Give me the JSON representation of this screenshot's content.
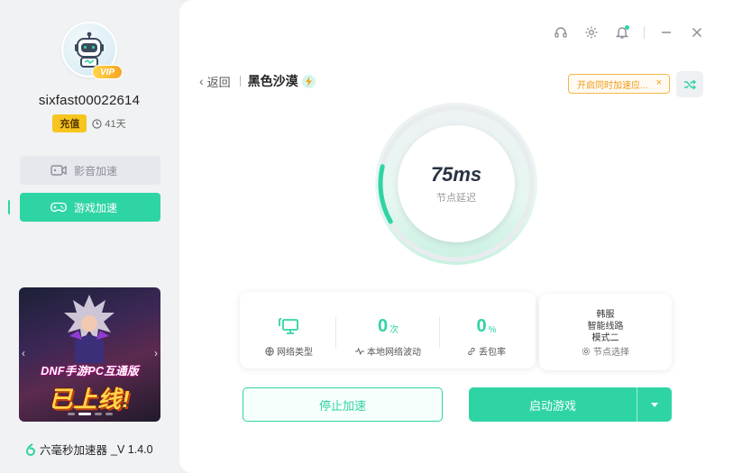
{
  "user": {
    "name": "sixfast00022614",
    "vip_label": "VIP",
    "recharge_label": "充值",
    "days_left": "41天"
  },
  "sidebar": {
    "items": [
      {
        "label": "影音加速",
        "icon": "video-icon",
        "active": false
      },
      {
        "label": "游戏加速",
        "icon": "gamepad-icon",
        "active": true
      }
    ]
  },
  "banner": {
    "line1": "DNF手游PC互通版",
    "line2": "已上线!"
  },
  "app": {
    "name": "六毫秒加速器",
    "version": "_V 1.4.0"
  },
  "header": {
    "back_label": "返回",
    "game_title": "黑色沙漠",
    "sim_tag": "开启同时加速应...",
    "sim_tag_close": "×"
  },
  "latency": {
    "value": "75ms",
    "label": "节点延迟",
    "ring_fraction": 0.12
  },
  "stats": [
    {
      "value": "",
      "unit": "",
      "label": "网络类型",
      "icon": "monitor-icon",
      "label_icon": "globe-icon"
    },
    {
      "value": "0",
      "unit": "次",
      "label": "本地网络波动",
      "label_icon": "pulse-icon"
    },
    {
      "value": "0",
      "unit": "%",
      "label": "丢包率",
      "label_icon": "link-icon"
    }
  ],
  "node": {
    "lines": [
      "韩服",
      "智能线路",
      "模式二"
    ],
    "label": "节点选择"
  },
  "actions": {
    "stop_label": "停止加速",
    "start_label": "启动游戏"
  },
  "colors": {
    "accent": "#2fd4a5",
    "warning": "#ef9b1a",
    "vip": "#f7c51f"
  }
}
